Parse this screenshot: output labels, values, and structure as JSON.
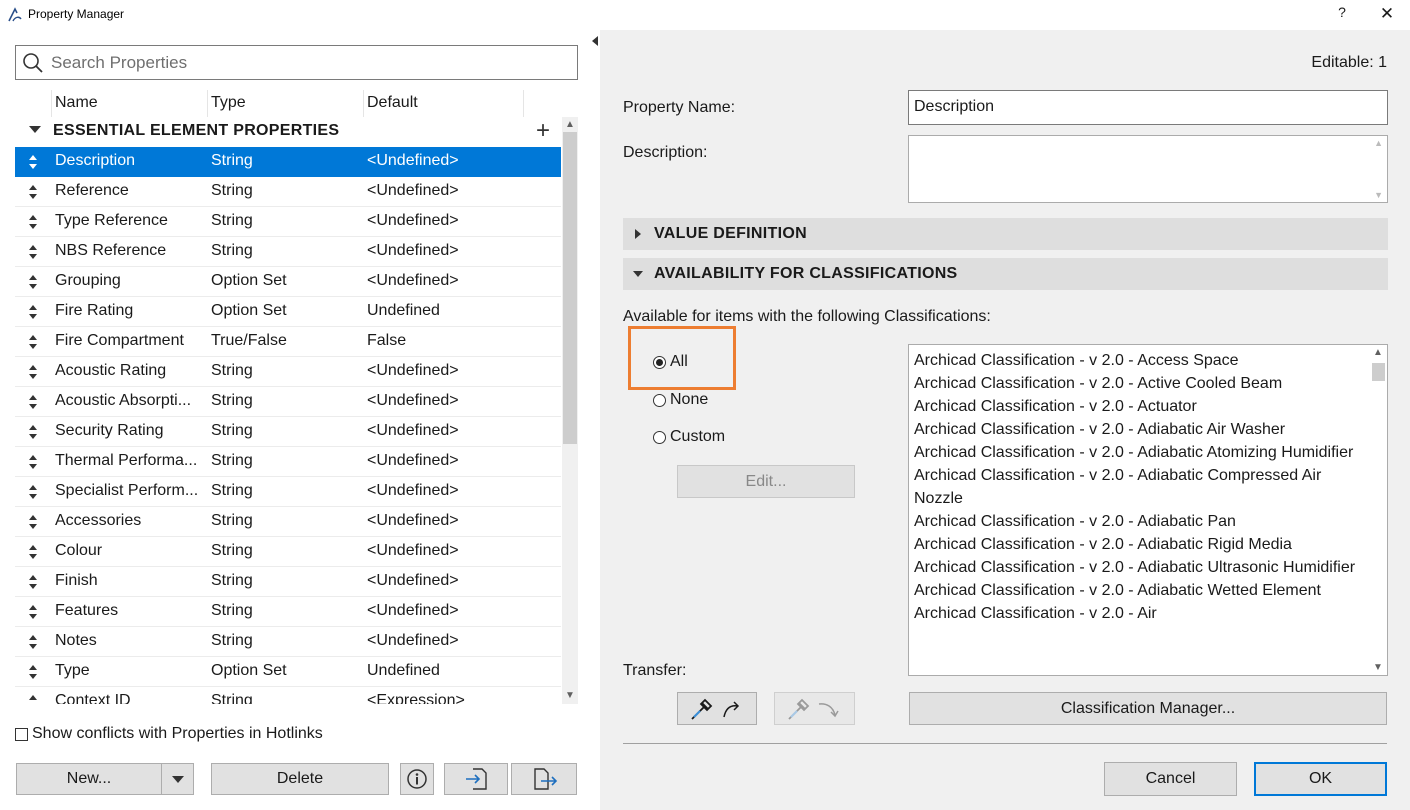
{
  "window": {
    "title": "Property Manager",
    "help_label": "?",
    "close_label": "✕"
  },
  "left": {
    "search_placeholder": "Search Properties",
    "columns": [
      "Name",
      "Type",
      "Default"
    ],
    "group": {
      "label": "ESSENTIAL ELEMENT PROPERTIES",
      "add_label": "+"
    },
    "rows": [
      {
        "name": "Description",
        "type": "String",
        "default": "<Undefined>",
        "selected": true
      },
      {
        "name": "Reference",
        "type": "String",
        "default": "<Undefined>"
      },
      {
        "name": "Type Reference",
        "type": "String",
        "default": "<Undefined>"
      },
      {
        "name": "NBS Reference",
        "type": "String",
        "default": "<Undefined>"
      },
      {
        "name": "Grouping",
        "type": "Option Set",
        "default": "<Undefined>"
      },
      {
        "name": "Fire Rating",
        "type": "Option Set",
        "default": "Undefined"
      },
      {
        "name": "Fire Compartment",
        "type": "True/False",
        "default": "False"
      },
      {
        "name": "Acoustic Rating",
        "type": "String",
        "default": "<Undefined>"
      },
      {
        "name": "Acoustic Absorpti...",
        "type": "String",
        "default": "<Undefined>"
      },
      {
        "name": "Security Rating",
        "type": "String",
        "default": "<Undefined>"
      },
      {
        "name": "Thermal Performa...",
        "type": "String",
        "default": "<Undefined>"
      },
      {
        "name": "Specialist Perform...",
        "type": "String",
        "default": "<Undefined>"
      },
      {
        "name": "Accessories",
        "type": "String",
        "default": "<Undefined>"
      },
      {
        "name": "Colour",
        "type": "String",
        "default": "<Undefined>"
      },
      {
        "name": "Finish",
        "type": "String",
        "default": "<Undefined>"
      },
      {
        "name": "Features",
        "type": "String",
        "default": "<Undefined>"
      },
      {
        "name": "Notes",
        "type": "String",
        "default": "<Undefined>"
      },
      {
        "name": "Type",
        "type": "Option Set",
        "default": "Undefined"
      },
      {
        "name": "Context ID",
        "type": "String",
        "default": "<Expression>"
      }
    ],
    "show_conflicts_label": "Show conflicts with Properties in Hotlinks",
    "new_label": "New...",
    "delete_label": "Delete"
  },
  "right": {
    "editable_label": "Editable: 1",
    "property_name_label": "Property Name:",
    "property_name_value": "Description",
    "description_label": "Description:",
    "description_value": "",
    "value_definition_label": "VALUE DEFINITION",
    "availability_label": "AVAILABILITY FOR CLASSIFICATIONS",
    "available_text": "Available for items with the following Classifications:",
    "radio_all": "All",
    "radio_none": "None",
    "radio_custom": "Custom",
    "selected_radio": "All",
    "edit_label": "Edit...",
    "classifications": [
      "Archicad Classification - v 2.0 - Access Space",
      "Archicad Classification - v 2.0 - Active Cooled Beam",
      "Archicad Classification - v 2.0 - Actuator",
      "Archicad Classification - v 2.0 - Adiabatic Air Washer",
      "Archicad Classification - v 2.0 - Adiabatic Atomizing Humidifier",
      "Archicad Classification - v 2.0 - Adiabatic Compressed Air Nozzle",
      "Archicad Classification - v 2.0 - Adiabatic Pan",
      "Archicad Classification - v 2.0 - Adiabatic Rigid Media",
      "Archicad Classification - v 2.0 - Adiabatic Ultrasonic Humidifier",
      "Archicad Classification - v 2.0 - Adiabatic Wetted Element",
      "Archicad Classification - v 2.0 - Air"
    ],
    "transfer_label": "Transfer:",
    "classification_manager_label": "Classification Manager...",
    "cancel_label": "Cancel",
    "ok_label": "OK"
  },
  "colors": {
    "selection": "#0078d7",
    "highlight_box": "#ed7d31"
  }
}
